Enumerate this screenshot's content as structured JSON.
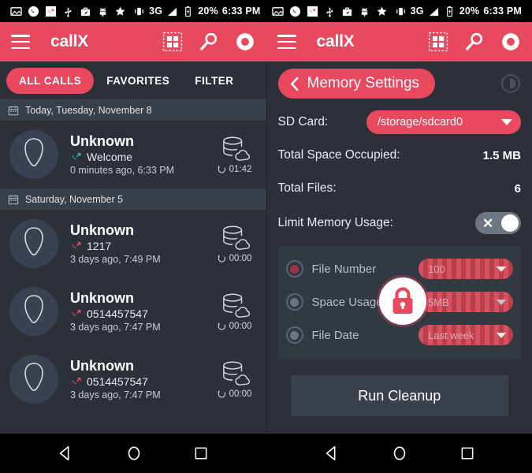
{
  "statusbar": {
    "icons_left": [
      "image-icon",
      "phone-circle-icon",
      "missed-call-icon",
      "usb-icon",
      "briefcase-icon",
      "android-icon",
      "star-icon"
    ],
    "vibrate_icon": "vibrate-icon",
    "network": "3G",
    "signal_icon": "signal-icon",
    "battery_icon": "battery-icon",
    "battery_level": "20%",
    "clock": "6:33 PM"
  },
  "appbar": {
    "title": "callX",
    "menu_icon": "hamburger-menu-icon",
    "grid_icon": "grid-apps-icon",
    "search_icon": "search-icon",
    "record_icon": "record-icon"
  },
  "left_pane": {
    "tabs": [
      {
        "label": "ALL CALLS",
        "active": true
      },
      {
        "label": "FAVORITES",
        "active": false
      },
      {
        "label": "FILTER",
        "active": false
      }
    ],
    "groups": [
      {
        "date_label": "Today, Tuesday, November 8",
        "calls": [
          {
            "name": "Unknown",
            "number": "Welcome",
            "direction": "incoming",
            "time": "0 minutes ago, 6:33 PM",
            "duration": "01:42",
            "storage_icon": "database-cloud-icon",
            "timer_icon": "timer-icon"
          }
        ]
      },
      {
        "date_label": "Saturday, November 5",
        "calls": [
          {
            "name": "Unknown",
            "number": "1217",
            "direction": "missed",
            "time": "3 days ago, 7:49 PM",
            "duration": "00:00",
            "storage_icon": "database-cloud-icon",
            "timer_icon": "timer-icon"
          },
          {
            "name": "Unknown",
            "number": "0514457547",
            "direction": "missed",
            "time": "3 days ago, 7:47 PM",
            "duration": "00:00",
            "storage_icon": "database-cloud-icon",
            "timer_icon": "timer-icon"
          },
          {
            "name": "Unknown",
            "number": "0514457547",
            "direction": "missed",
            "time": "3 days ago, 7:47 PM",
            "duration": "00:00",
            "storage_icon": "database-cloud-icon",
            "timer_icon": "timer-icon"
          }
        ]
      }
    ]
  },
  "right_pane": {
    "header": {
      "title": "Memory Settings",
      "back_icon": "chevron-left-icon",
      "help_icon": "help-circle-icon"
    },
    "sd_card": {
      "label": "SD Card:",
      "value": "/storage/sdcard0",
      "caret_icon": "caret-down-icon"
    },
    "stats": [
      {
        "label": "Total Space Occupied:",
        "value": "1.5 MB"
      },
      {
        "label": "Total Files:",
        "value": "6"
      }
    ],
    "limit_toggle": {
      "label": "Limit Memory Usage:",
      "state": "off",
      "x_glyph": "✕"
    },
    "locked_options": {
      "lock_icon": "lock-icon",
      "options": [
        {
          "label": "File Number",
          "selected": true,
          "value": "100",
          "caret_icon": "caret-down-icon"
        },
        {
          "label": "Space Usage",
          "selected": false,
          "value": "5MB",
          "caret_icon": "caret-down-icon"
        },
        {
          "label": "File Date",
          "selected": false,
          "value": "Last week",
          "caret_icon": "caret-down-icon"
        }
      ]
    },
    "cleanup_button": "Run Cleanup"
  },
  "navbar": {
    "back_icon": "back-triangle-icon",
    "home_icon": "home-circle-icon",
    "recents_icon": "recents-square-icon"
  },
  "colors": {
    "accent": "#e8495e",
    "bg": "#2b3039",
    "bg_alt": "#383f4b",
    "incoming": "#2fb9b0",
    "missed": "#e8495e",
    "locked_panel": "#333943"
  }
}
